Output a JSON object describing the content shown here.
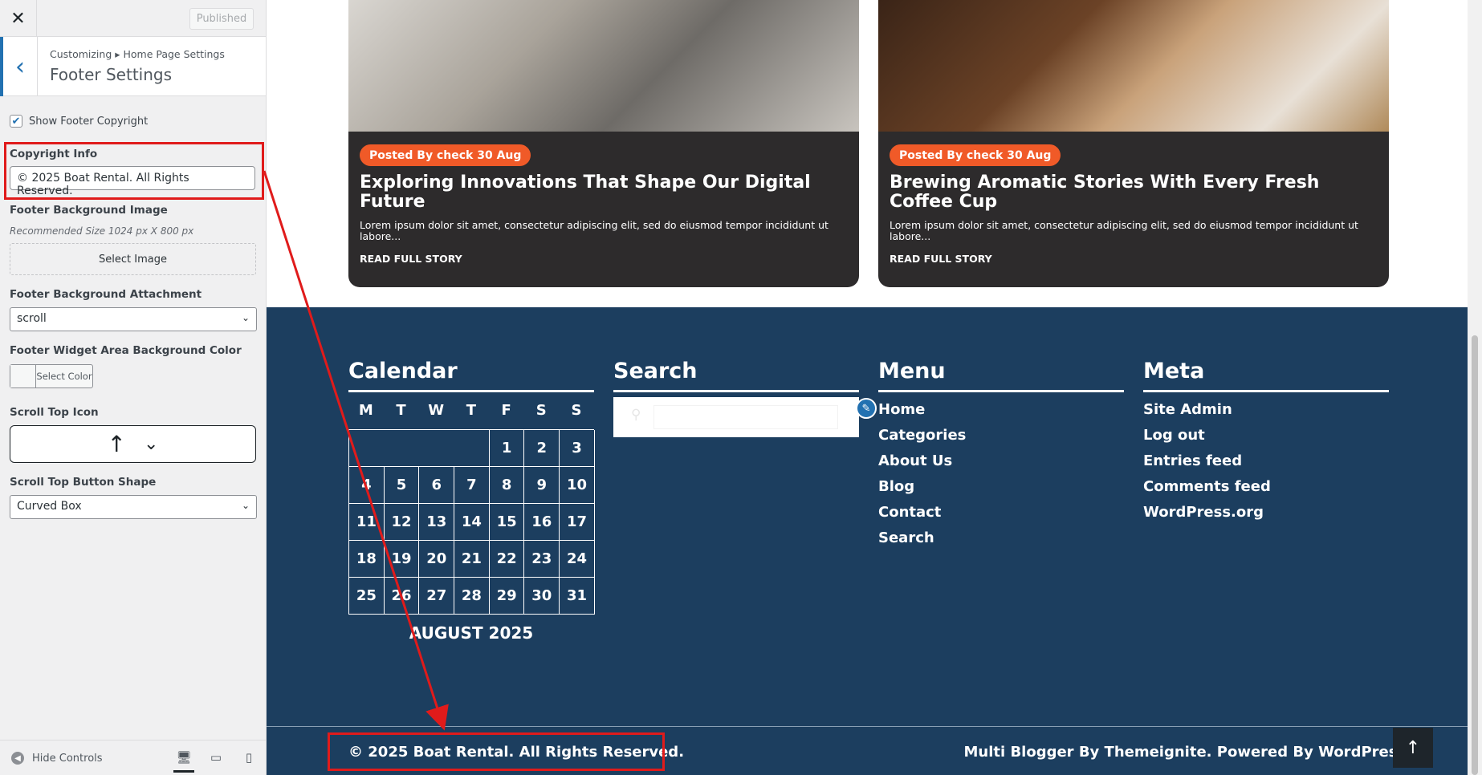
{
  "sidebar": {
    "close_icon": "close-icon",
    "published_label": "Published",
    "breadcrumb": "Customizing ▸ Home Page Settings",
    "section_title": "Footer Settings",
    "show_copyright_label": "Show Footer Copyright",
    "show_copyright_checked": true,
    "copyright_label": "Copyright Info",
    "copyright_value": "© 2025 Boat Rental. All Rights Reserved.",
    "bg_image_label": "Footer Background Image",
    "bg_image_desc": "Recommended Size 1024 px X 800 px",
    "select_image_label": "Select Image",
    "bg_attachment_label": "Footer Background Attachment",
    "bg_attachment_value": "scroll",
    "widget_bg_label": "Footer Widget Area Background Color",
    "select_color_label": "Select Color",
    "scroll_icon_label": "Scroll Top Icon",
    "scroll_shape_label": "Scroll Top Button Shape",
    "scroll_shape_value": "Curved Box",
    "hide_controls_label": "Hide Controls"
  },
  "posts": [
    {
      "badge": "Posted By check 30 Aug",
      "title": "Exploring Innovations That Shape Our Digital Future",
      "excerpt": "Lorem ipsum dolor sit amet, consectetur adipiscing elit, sed do eiusmod tempor incididunt ut labore...",
      "link": "READ FULL STORY"
    },
    {
      "badge": "Posted By check 30 Aug",
      "title": "Brewing Aromatic Stories With Every Fresh Coffee Cup",
      "excerpt": "Lorem ipsum dolor sit amet, consectetur adipiscing elit, sed do eiusmod tempor incididunt ut labore...",
      "link": "READ FULL STORY"
    }
  ],
  "footer": {
    "calendar_title": "Calendar",
    "search_title": "Search",
    "menu_title": "Menu",
    "meta_title": "Meta",
    "weekdays": [
      "M",
      "T",
      "W",
      "T",
      "F",
      "S",
      "S"
    ],
    "days": [
      "1",
      "2",
      "3",
      "4",
      "5",
      "6",
      "7",
      "8",
      "9",
      "10",
      "11",
      "12",
      "13",
      "14",
      "15",
      "16",
      "17",
      "18",
      "19",
      "20",
      "21",
      "22",
      "23",
      "24",
      "25",
      "26",
      "27",
      "28",
      "29",
      "30",
      "31"
    ],
    "calendar_caption": "AUGUST 2025",
    "menu_items": [
      "Home",
      "Categories",
      "About Us",
      "Blog",
      "Contact",
      "Search"
    ],
    "meta_items": [
      "Site Admin",
      "Log out",
      "Entries feed",
      "Comments feed",
      "WordPress.org"
    ],
    "copyright": "© 2025 Boat Rental. All Rights Reserved.",
    "credits": "Multi Blogger By Themeignite. Powered By WordPress."
  },
  "colors": {
    "footer_bg": "#1c3e5f",
    "badge": "#f05a28",
    "card_bg": "#2d2b2c",
    "highlight": "#e01b1b",
    "wp_accent": "#2271b1"
  }
}
